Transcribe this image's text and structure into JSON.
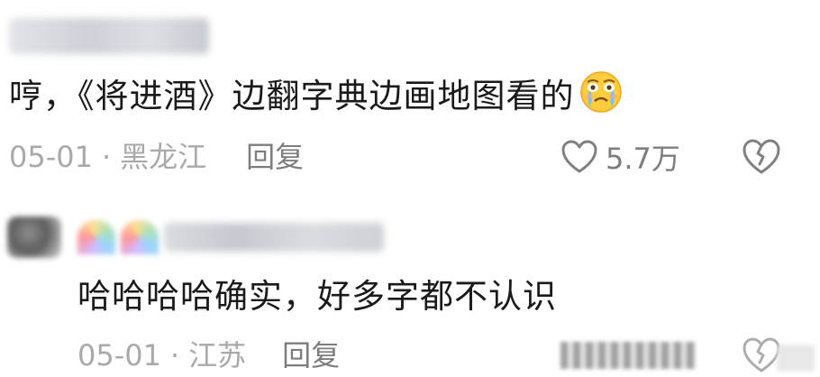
{
  "comments": [
    {
      "text": "哼，《将进酒》边翻字典边画地图看的",
      "emoji": "crying-face-emoji",
      "date": "05-01",
      "separator": "·",
      "location": "黑龙江",
      "reply_label": "回复",
      "likes": "5.7万"
    },
    {
      "text": "哈哈哈哈确实，好多字都不认识",
      "date": "05-01",
      "separator": "·",
      "location": "江苏",
      "reply_label": "回复"
    }
  ],
  "icons": {
    "like": "heart-outline-icon",
    "dislike": "broken-heart-icon"
  },
  "colors": {
    "text": "#1a1a1a",
    "meta": "#a9a9a9",
    "action": "#7d7d7d"
  }
}
